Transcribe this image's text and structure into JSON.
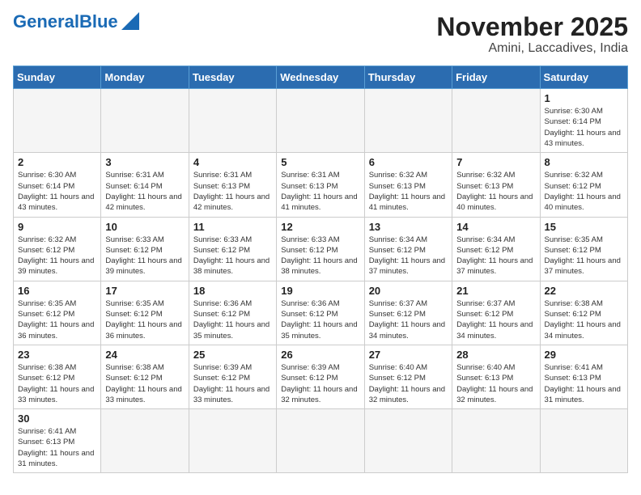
{
  "header": {
    "logo_general": "General",
    "logo_blue": "Blue",
    "month_title": "November 2025",
    "location": "Amini, Laccadives, India"
  },
  "weekdays": [
    "Sunday",
    "Monday",
    "Tuesday",
    "Wednesday",
    "Thursday",
    "Friday",
    "Saturday"
  ],
  "days": [
    {
      "num": "",
      "info": ""
    },
    {
      "num": "",
      "info": ""
    },
    {
      "num": "",
      "info": ""
    },
    {
      "num": "",
      "info": ""
    },
    {
      "num": "",
      "info": ""
    },
    {
      "num": "",
      "info": ""
    },
    {
      "num": "1",
      "info": "Sunrise: 6:30 AM\nSunset: 6:14 PM\nDaylight: 11 hours\nand 43 minutes."
    },
    {
      "num": "2",
      "info": "Sunrise: 6:30 AM\nSunset: 6:14 PM\nDaylight: 11 hours\nand 43 minutes."
    },
    {
      "num": "3",
      "info": "Sunrise: 6:31 AM\nSunset: 6:14 PM\nDaylight: 11 hours\nand 42 minutes."
    },
    {
      "num": "4",
      "info": "Sunrise: 6:31 AM\nSunset: 6:13 PM\nDaylight: 11 hours\nand 42 minutes."
    },
    {
      "num": "5",
      "info": "Sunrise: 6:31 AM\nSunset: 6:13 PM\nDaylight: 11 hours\nand 41 minutes."
    },
    {
      "num": "6",
      "info": "Sunrise: 6:32 AM\nSunset: 6:13 PM\nDaylight: 11 hours\nand 41 minutes."
    },
    {
      "num": "7",
      "info": "Sunrise: 6:32 AM\nSunset: 6:13 PM\nDaylight: 11 hours\nand 40 minutes."
    },
    {
      "num": "8",
      "info": "Sunrise: 6:32 AM\nSunset: 6:12 PM\nDaylight: 11 hours\nand 40 minutes."
    },
    {
      "num": "9",
      "info": "Sunrise: 6:32 AM\nSunset: 6:12 PM\nDaylight: 11 hours\nand 39 minutes."
    },
    {
      "num": "10",
      "info": "Sunrise: 6:33 AM\nSunset: 6:12 PM\nDaylight: 11 hours\nand 39 minutes."
    },
    {
      "num": "11",
      "info": "Sunrise: 6:33 AM\nSunset: 6:12 PM\nDaylight: 11 hours\nand 38 minutes."
    },
    {
      "num": "12",
      "info": "Sunrise: 6:33 AM\nSunset: 6:12 PM\nDaylight: 11 hours\nand 38 minutes."
    },
    {
      "num": "13",
      "info": "Sunrise: 6:34 AM\nSunset: 6:12 PM\nDaylight: 11 hours\nand 37 minutes."
    },
    {
      "num": "14",
      "info": "Sunrise: 6:34 AM\nSunset: 6:12 PM\nDaylight: 11 hours\nand 37 minutes."
    },
    {
      "num": "15",
      "info": "Sunrise: 6:35 AM\nSunset: 6:12 PM\nDaylight: 11 hours\nand 37 minutes."
    },
    {
      "num": "16",
      "info": "Sunrise: 6:35 AM\nSunset: 6:12 PM\nDaylight: 11 hours\nand 36 minutes."
    },
    {
      "num": "17",
      "info": "Sunrise: 6:35 AM\nSunset: 6:12 PM\nDaylight: 11 hours\nand 36 minutes."
    },
    {
      "num": "18",
      "info": "Sunrise: 6:36 AM\nSunset: 6:12 PM\nDaylight: 11 hours\nand 35 minutes."
    },
    {
      "num": "19",
      "info": "Sunrise: 6:36 AM\nSunset: 6:12 PM\nDaylight: 11 hours\nand 35 minutes."
    },
    {
      "num": "20",
      "info": "Sunrise: 6:37 AM\nSunset: 6:12 PM\nDaylight: 11 hours\nand 34 minutes."
    },
    {
      "num": "21",
      "info": "Sunrise: 6:37 AM\nSunset: 6:12 PM\nDaylight: 11 hours\nand 34 minutes."
    },
    {
      "num": "22",
      "info": "Sunrise: 6:38 AM\nSunset: 6:12 PM\nDaylight: 11 hours\nand 34 minutes."
    },
    {
      "num": "23",
      "info": "Sunrise: 6:38 AM\nSunset: 6:12 PM\nDaylight: 11 hours\nand 33 minutes."
    },
    {
      "num": "24",
      "info": "Sunrise: 6:38 AM\nSunset: 6:12 PM\nDaylight: 11 hours\nand 33 minutes."
    },
    {
      "num": "25",
      "info": "Sunrise: 6:39 AM\nSunset: 6:12 PM\nDaylight: 11 hours\nand 33 minutes."
    },
    {
      "num": "26",
      "info": "Sunrise: 6:39 AM\nSunset: 6:12 PM\nDaylight: 11 hours\nand 32 minutes."
    },
    {
      "num": "27",
      "info": "Sunrise: 6:40 AM\nSunset: 6:12 PM\nDaylight: 11 hours\nand 32 minutes."
    },
    {
      "num": "28",
      "info": "Sunrise: 6:40 AM\nSunset: 6:13 PM\nDaylight: 11 hours\nand 32 minutes."
    },
    {
      "num": "29",
      "info": "Sunrise: 6:41 AM\nSunset: 6:13 PM\nDaylight: 11 hours\nand 31 minutes."
    },
    {
      "num": "30",
      "info": "Sunrise: 6:41 AM\nSunset: 6:13 PM\nDaylight: 11 hours\nand 31 minutes."
    },
    {
      "num": "",
      "info": ""
    },
    {
      "num": "",
      "info": ""
    },
    {
      "num": "",
      "info": ""
    },
    {
      "num": "",
      "info": ""
    },
    {
      "num": "",
      "info": ""
    },
    {
      "num": "",
      "info": ""
    }
  ]
}
